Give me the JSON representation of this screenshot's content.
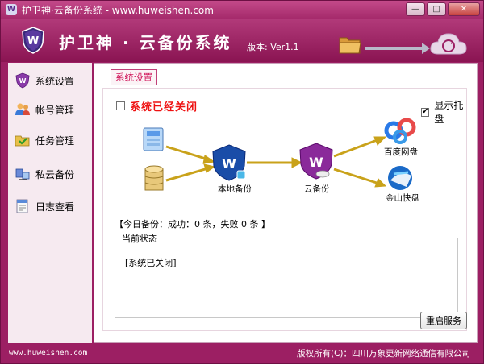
{
  "window": {
    "title": "护卫神·云备份系统 - www.huweishen.com",
    "icon_letter": "W",
    "controls": [
      "minimize",
      "maximize",
      "close"
    ],
    "control_glyphs": {
      "minimize": "—",
      "maximize": "□",
      "close": "✕"
    }
  },
  "banner": {
    "app_title": "护卫神 · 云备份系统",
    "version": "版本: Ver1.1",
    "icons": [
      "shield-logo-icon",
      "folder-icon",
      "arrow-icon",
      "cloud-sync-icon"
    ]
  },
  "sidebar": {
    "items": [
      {
        "label": "系统设置",
        "icon": "shield-icon"
      },
      {
        "label": "帐号管理",
        "icon": "users-icon"
      },
      {
        "label": "任务管理",
        "icon": "task-folder-icon"
      },
      {
        "label": "私云备份",
        "icon": "private-cloud-icon"
      },
      {
        "label": "日志查看",
        "icon": "log-icon"
      }
    ]
  },
  "main": {
    "tab_label": "系统设置",
    "system_status_label": "系统已经关闭",
    "system_status_checked": false,
    "show_tray_label": "显示托盘",
    "show_tray_checked": true,
    "local_backup_label": "本地备份",
    "cloud_backup_label": "云备份",
    "baidu_label": "百度网盘",
    "kingsoft_label": "金山快盘",
    "today_backup": "【今日备份：成功：0 条，失败 0 条 】",
    "current_status_title": "当前状态",
    "current_status_text": "[系统已关闭]",
    "restart_button": "重启服务"
  },
  "footer": {
    "url": "www.huweishen.com",
    "copyright": "版权所有(C)：四川万象更新网络通信有限公司"
  },
  "colors": {
    "frame": "#9c1f63",
    "accent_red": "#e11111",
    "arrow": "#c9a21a",
    "shield_blue": "#1a4da8",
    "shield_purple": "#8a2a9a"
  }
}
